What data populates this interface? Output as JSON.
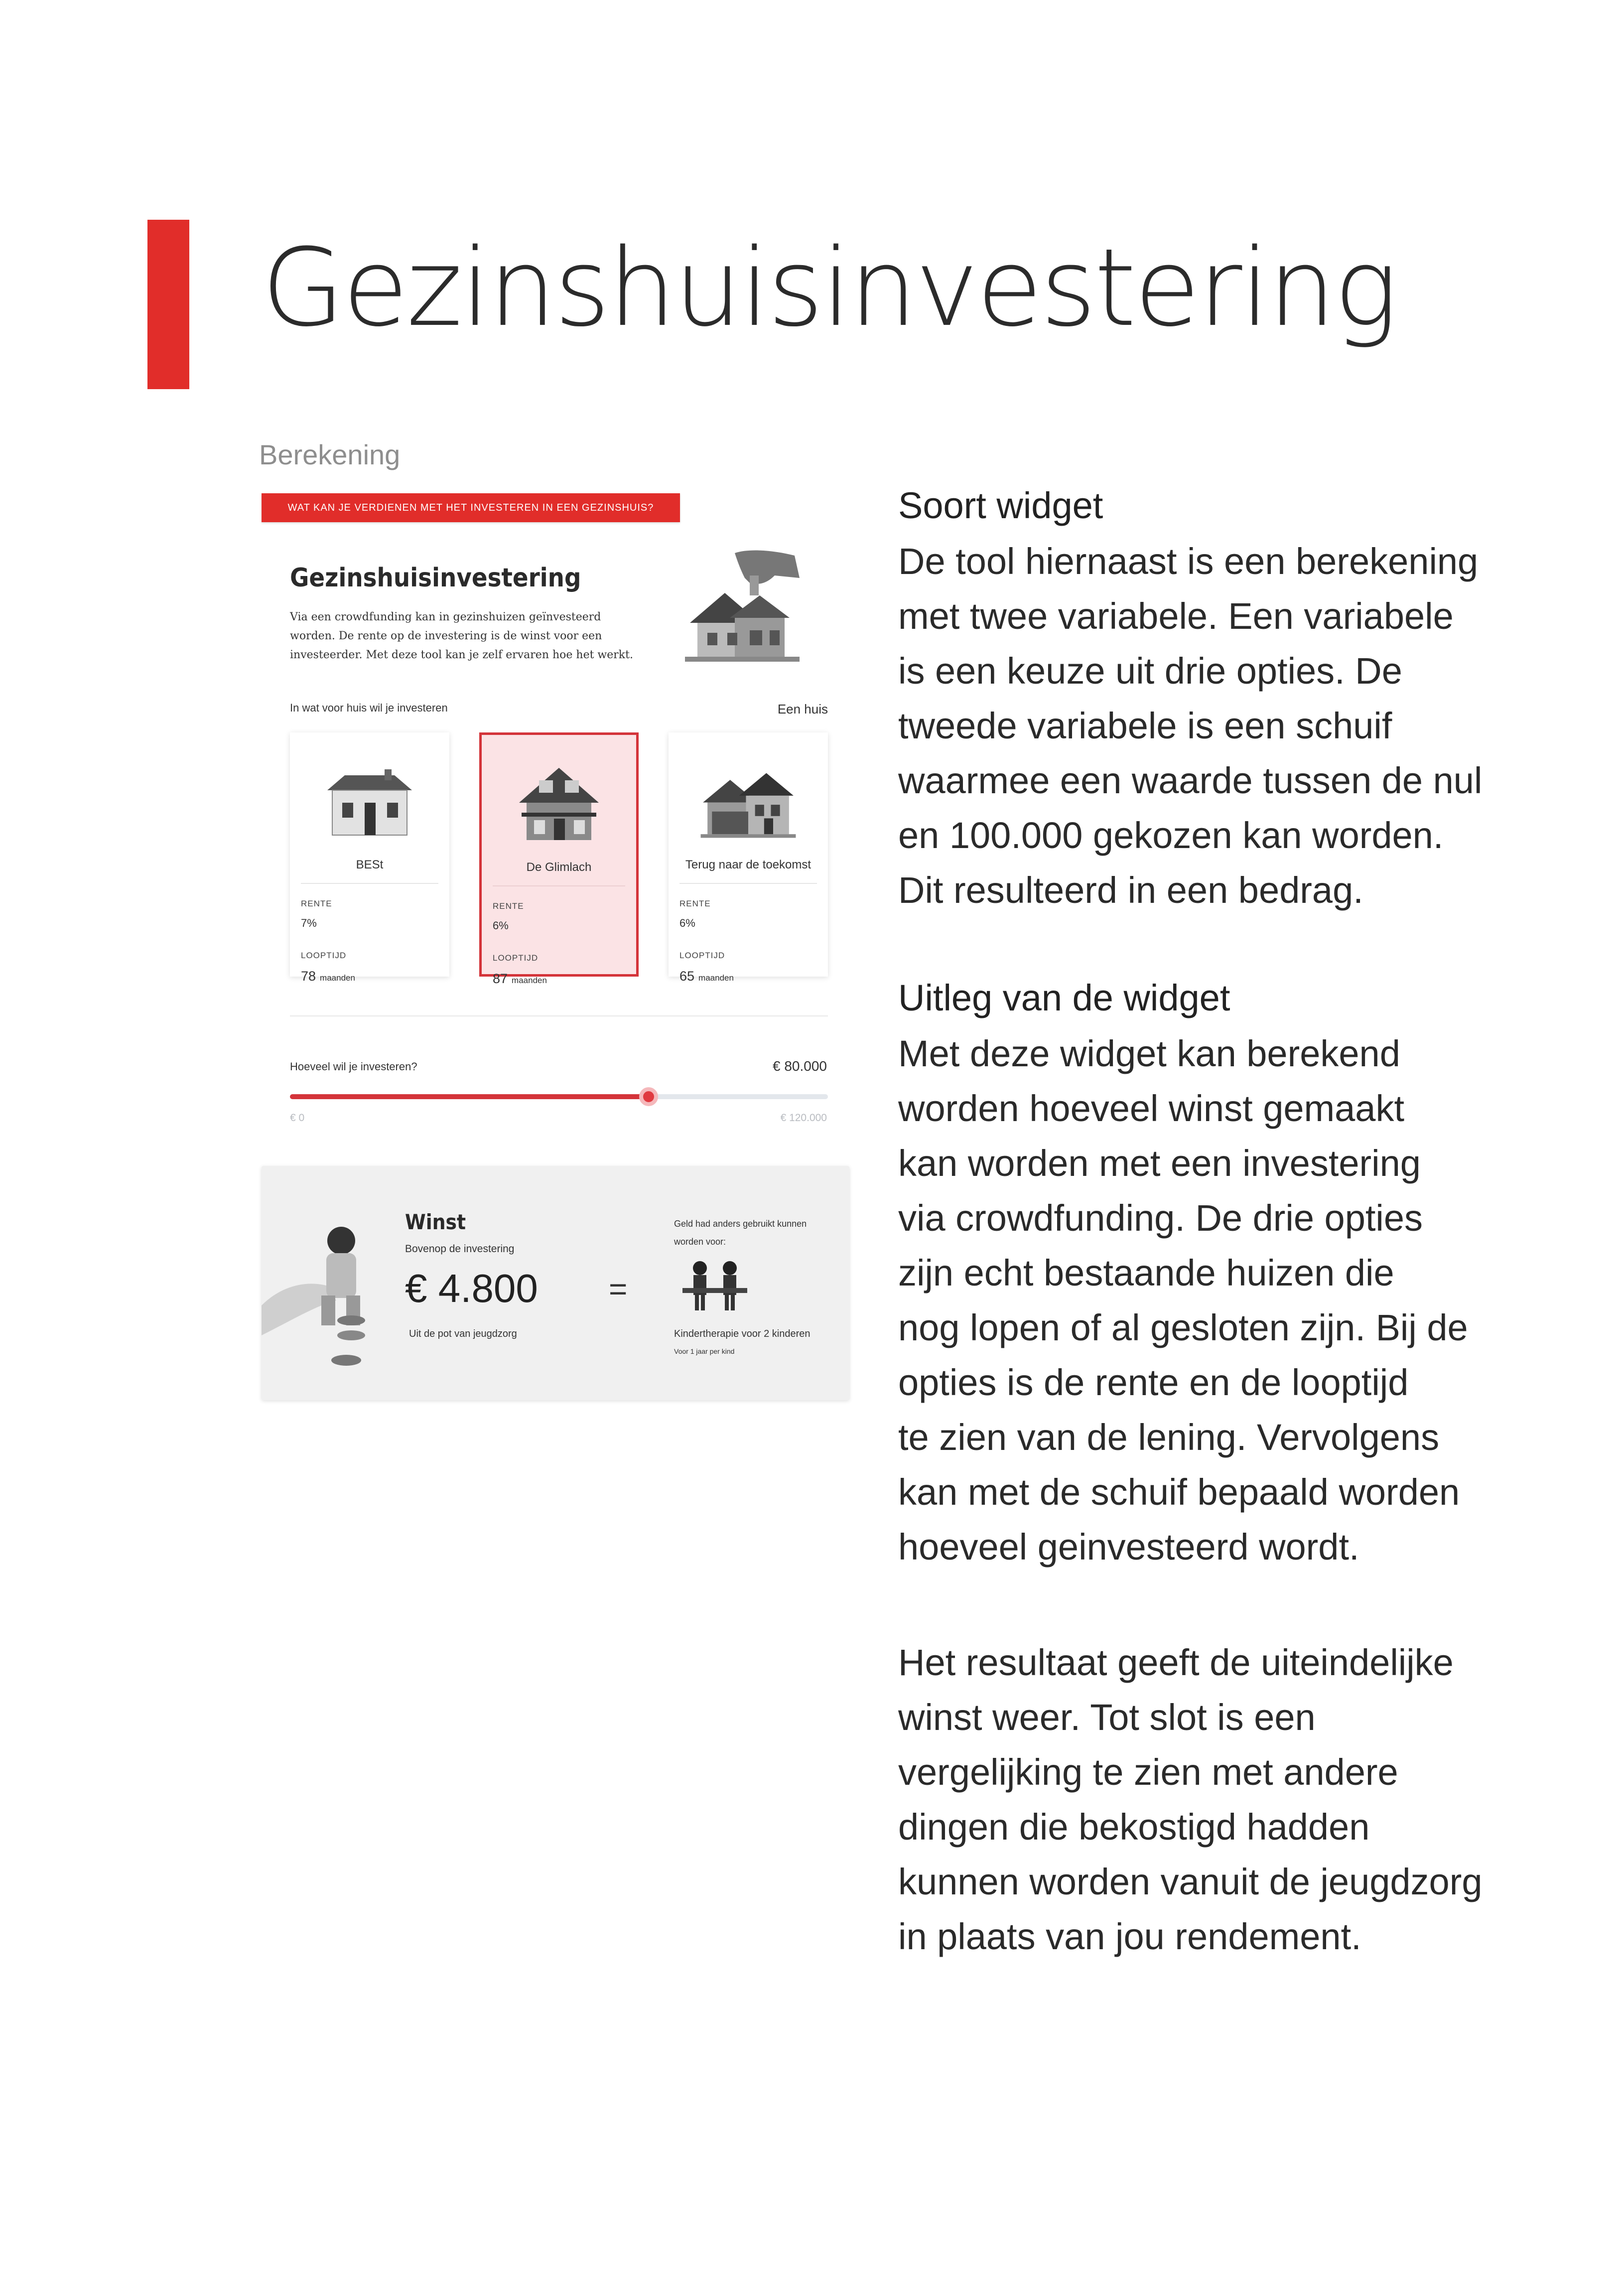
{
  "page": {
    "title": "Gezinshuisinvestering",
    "section_label": "Berekening",
    "accent_color": "#e12d2a"
  },
  "widget": {
    "banner": "WAT KAN JE VERDIENEN MET HET INVESTEREN IN EEN GEZINSHUIS?",
    "title": "Gezinshuisinvestering",
    "intro": "Via een crowdfunding kan in gezinshuizen geïnvesteerd worden. De rente op de investering is de winst voor een investeerder. Met deze tool kan je zelf ervaren hoe het werkt.",
    "question": "In wat voor huis wil je investeren",
    "selected_label": "Een huis",
    "rate_label": "RENTE",
    "term_label": "LOOPTIJD",
    "months_label": "maanden",
    "houses": [
      {
        "name": "BESt",
        "rate": "7%",
        "term": "78",
        "selected": false
      },
      {
        "name": "De Glimlach",
        "rate": "6%",
        "term": "87",
        "selected": true
      },
      {
        "name": "Terug naar de toekomst",
        "rate": "6%",
        "term": "65",
        "selected": false
      }
    ],
    "slider": {
      "label": "Hoeveel wil je investeren?",
      "value_text": "€ 80.000",
      "min_text": "€ 0",
      "max_text": "€ 120.000",
      "value": 80000,
      "min": 0,
      "max": 120000
    }
  },
  "result": {
    "title": "Winst",
    "subtitle": "Bovenop de investering",
    "amount": "€ 4.800",
    "source": "Uit de pot van jeugdzorg",
    "equals": "=",
    "other_use": "Geld had anders gebruikt kunnen worden voor:",
    "therapy": "Kindertherapie voor 2 kinderen",
    "therapy_sub": "Voor 1 jaar per kind"
  },
  "text": {
    "h1": "Soort widget",
    "p1": [
      "De tool hiernaast is een berekening",
      "met twee variabele. Een variabele",
      "is een keuze uit drie opties. De",
      "tweede variabele is een schuif",
      "waarmee een waarde tussen de nul",
      "en 100.000 gekozen kan worden.",
      "Dit resulteerd in een bedrag."
    ],
    "h2": "Uitleg van de widget",
    "p2": [
      "Met deze widget kan berekend",
      "worden hoeveel winst gemaakt",
      "kan worden met een investering",
      "via crowdfunding. De drie opties",
      "zijn echt bestaande huizen die",
      "nog lopen of al gesloten zijn. Bij de",
      "opties is de rente en de looptijd",
      "te zien van de lening. Vervolgens",
      "kan met de schuif bepaald worden",
      "hoeveel geinvesteerd wordt."
    ],
    "p3": [
      "Het resultaat geeft de uiteindelijke",
      "winst weer. Tot slot is een",
      "vergelijking te zien met andere",
      "dingen die bekostigd hadden",
      "kunnen worden vanuit de jeugdzorg",
      "in plaats van jou rendement."
    ]
  }
}
